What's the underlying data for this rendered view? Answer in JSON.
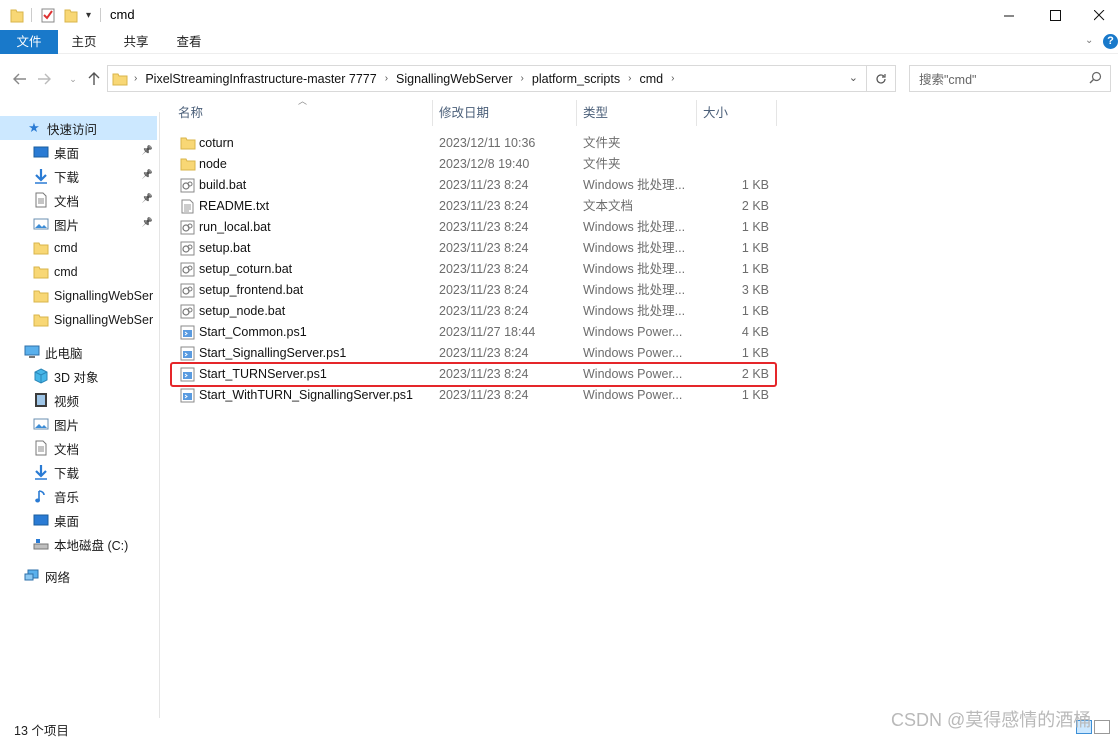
{
  "window": {
    "title": "cmd"
  },
  "ribbon": {
    "tabs": [
      "文件",
      "主页",
      "共享",
      "查看"
    ]
  },
  "address": {
    "crumbs": [
      "PixelStreamingInfrastructure-master 7777",
      "SignallingWebServer",
      "platform_scripts",
      "cmd"
    ]
  },
  "search": {
    "placeholder": "搜索\"cmd\""
  },
  "nav": {
    "quick_access": "快速访问",
    "quick_items": [
      {
        "label": "桌面",
        "icon": "desktop-icon",
        "pinned": true
      },
      {
        "label": "下载",
        "icon": "download-icon",
        "pinned": true
      },
      {
        "label": "文档",
        "icon": "document-icon",
        "pinned": true
      },
      {
        "label": "图片",
        "icon": "pictures-icon",
        "pinned": true
      },
      {
        "label": "cmd",
        "icon": "folder-icon",
        "pinned": false
      },
      {
        "label": "cmd",
        "icon": "folder-icon",
        "pinned": false
      },
      {
        "label": "SignallingWebSer",
        "icon": "folder-icon",
        "pinned": false
      },
      {
        "label": "SignallingWebSer",
        "icon": "folder-icon",
        "pinned": false
      }
    ],
    "this_pc": "此电脑",
    "pc_items": [
      {
        "label": "3D 对象",
        "icon": "3d-objects-icon"
      },
      {
        "label": "视频",
        "icon": "video-icon"
      },
      {
        "label": "图片",
        "icon": "pictures-icon"
      },
      {
        "label": "文档",
        "icon": "document-icon"
      },
      {
        "label": "下载",
        "icon": "download-icon"
      },
      {
        "label": "音乐",
        "icon": "music-icon"
      },
      {
        "label": "桌面",
        "icon": "desktop-icon"
      },
      {
        "label": "本地磁盘 (C:)",
        "icon": "drive-icon"
      }
    ],
    "network": "网络"
  },
  "columns": {
    "name": "名称",
    "date": "修改日期",
    "type": "类型",
    "size": "大小"
  },
  "files": [
    {
      "name": "coturn",
      "date": "2023/12/11 10:36",
      "type": "文件夹",
      "size": "",
      "icon": "folder-icon"
    },
    {
      "name": "node",
      "date": "2023/12/8 19:40",
      "type": "文件夹",
      "size": "",
      "icon": "folder-icon"
    },
    {
      "name": "build.bat",
      "date": "2023/11/23 8:24",
      "type": "Windows 批处理...",
      "size": "1 KB",
      "icon": "batch-file-icon"
    },
    {
      "name": "README.txt",
      "date": "2023/11/23 8:24",
      "type": "文本文档",
      "size": "2 KB",
      "icon": "text-file-icon"
    },
    {
      "name": "run_local.bat",
      "date": "2023/11/23 8:24",
      "type": "Windows 批处理...",
      "size": "1 KB",
      "icon": "batch-file-icon"
    },
    {
      "name": "setup.bat",
      "date": "2023/11/23 8:24",
      "type": "Windows 批处理...",
      "size": "1 KB",
      "icon": "batch-file-icon"
    },
    {
      "name": "setup_coturn.bat",
      "date": "2023/11/23 8:24",
      "type": "Windows 批处理...",
      "size": "1 KB",
      "icon": "batch-file-icon"
    },
    {
      "name": "setup_frontend.bat",
      "date": "2023/11/23 8:24",
      "type": "Windows 批处理...",
      "size": "3 KB",
      "icon": "batch-file-icon"
    },
    {
      "name": "setup_node.bat",
      "date": "2023/11/23 8:24",
      "type": "Windows 批处理...",
      "size": "1 KB",
      "icon": "batch-file-icon"
    },
    {
      "name": "Start_Common.ps1",
      "date": "2023/11/27 18:44",
      "type": "Windows Power...",
      "size": "4 KB",
      "icon": "powershell-file-icon"
    },
    {
      "name": "Start_SignallingServer.ps1",
      "date": "2023/11/23 8:24",
      "type": "Windows Power...",
      "size": "1 KB",
      "icon": "powershell-file-icon"
    },
    {
      "name": "Start_TURNServer.ps1",
      "date": "2023/11/23 8:24",
      "type": "Windows Power...",
      "size": "2 KB",
      "icon": "powershell-file-icon"
    },
    {
      "name": "Start_WithTURN_SignallingServer.ps1",
      "date": "2023/11/23 8:24",
      "type": "Windows Power...",
      "size": "1 KB",
      "icon": "powershell-file-icon"
    }
  ],
  "status": {
    "count": "13 个项目"
  },
  "watermark": "CSDN @莫得感情的酒桶",
  "colors": {
    "accent": "#1979ca",
    "highlight": "#e5262a",
    "selected": "#cce8ff"
  }
}
